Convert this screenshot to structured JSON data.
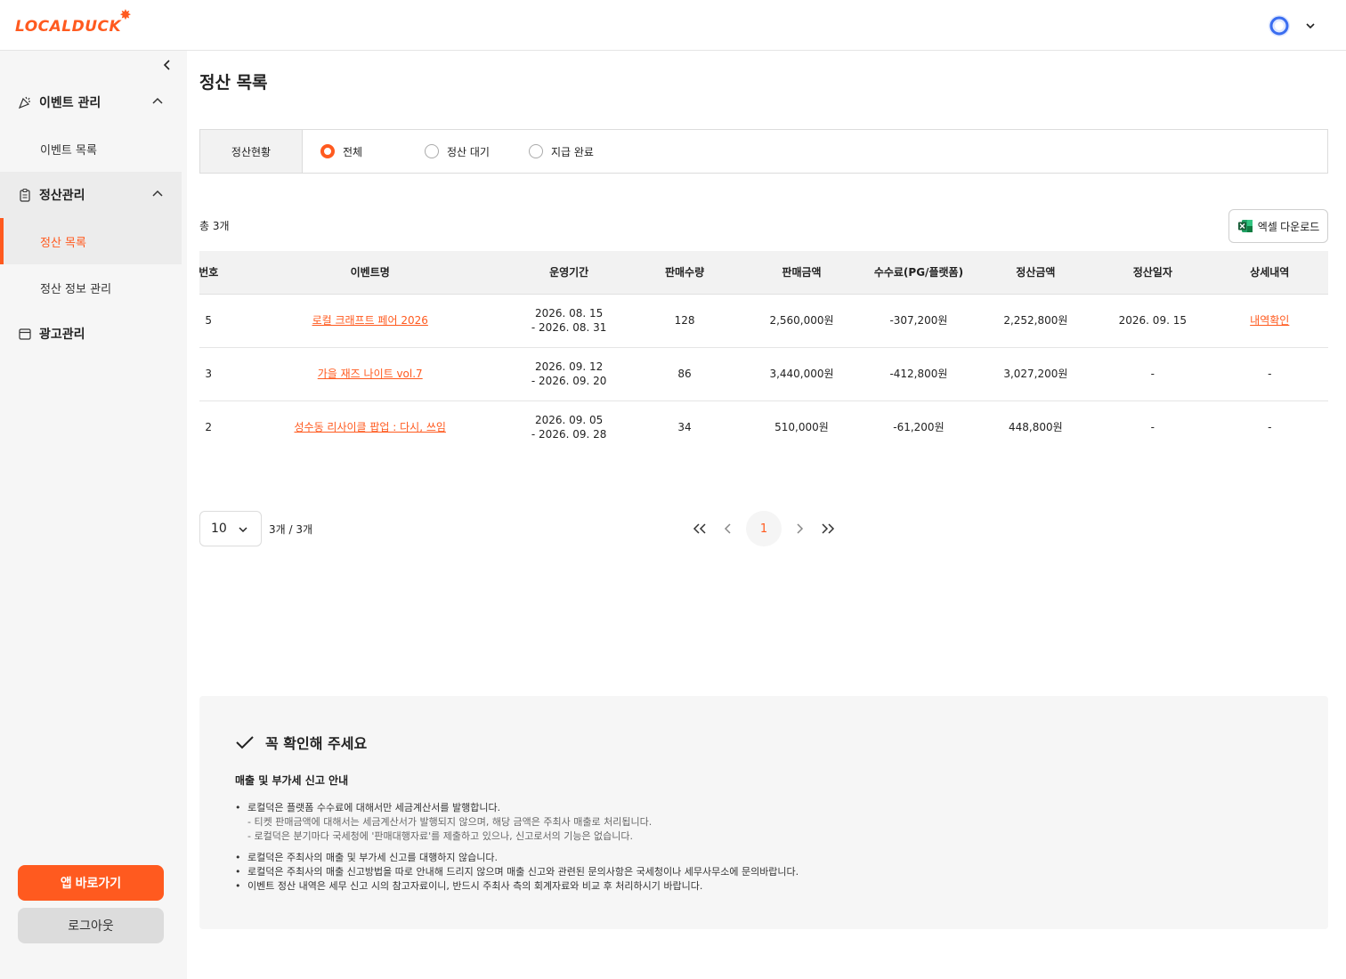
{
  "header": {
    "logo": "LOCALDUCK"
  },
  "sidebar": {
    "groups": [
      {
        "label": "이벤트 관리",
        "items": [
          "이벤트 목록"
        ]
      },
      {
        "label": "정산관리",
        "items": [
          "정산 목록",
          "정산 정보 관리"
        ]
      },
      {
        "label": "광고관리",
        "items": []
      }
    ],
    "active_item": "정산 목록",
    "app_button": "앱 바로가기",
    "logout_button": "로그아웃"
  },
  "page": {
    "title": "정산 목록"
  },
  "filter": {
    "label": "정산현황",
    "options": [
      "전체",
      "정산 대기",
      "지급 완료"
    ],
    "selected": "전체"
  },
  "summary": {
    "total": "총 3개",
    "excel_button": "엑셀 다운로드"
  },
  "table": {
    "headers": [
      "번호",
      "이벤트명",
      "운영기간",
      "판매수량",
      "판매금액",
      "수수료(PG/플랫폼)",
      "정산금액",
      "정산일자",
      "상세내역"
    ],
    "rows": [
      {
        "no": "5",
        "event": "로컬 크래프트 페어 2026",
        "period_start": "2026. 08. 15",
        "period_end": "- 2026. 08. 31",
        "qty": "128",
        "sales": "2,560,000원",
        "fee": "-307,200원",
        "settle": "2,252,800원",
        "date": "2026. 09. 15",
        "detail": "내역확인"
      },
      {
        "no": "3",
        "event": "가을 재즈 나이트 vol.7",
        "period_start": "2026. 09. 12",
        "period_end": "- 2026. 09. 20",
        "qty": "86",
        "sales": "3,440,000원",
        "fee": "-412,800원",
        "settle": "3,027,200원",
        "date": "-",
        "detail": "-"
      },
      {
        "no": "2",
        "event": "성수동 리사이클 팝업 : 다시, 쓰임",
        "period_start": "2026. 09. 05",
        "period_end": "- 2026. 09. 28",
        "qty": "34",
        "sales": "510,000원",
        "fee": "-61,200원",
        "settle": "448,800원",
        "date": "-",
        "detail": "-"
      }
    ]
  },
  "pagination": {
    "page_size": "10",
    "count_text": "3개 / 3개",
    "current_page": "1"
  },
  "notice": {
    "title": "꼭 확인해 주세요",
    "subtitle": "매출 및 부가세 신고 안내",
    "lines": [
      "로컬덕은 플랫폼 수수료에 대해서만 세금계산서를 발행합니다.",
      "- 티켓 판매금액에 대해서는 세금계산서가 발행되지 않으며, 해당 금액은 주최사 매출로 처리됩니다.",
      "- 로컬덕은 분기마다 국세청에 '판매대행자료'를 제출하고 있으나, 신고로서의 기능은 없습니다.",
      "로컬덕은 주최사의 매출 및 부가세 신고를 대행하지 않습니다.",
      "로컬덕은 주최사의 매출 신고방법을 따로 안내해 드리지 않으며 매출 신고와 관련된 문의사항은 국세청이나 세무사무소에 문의바랍니다.",
      "이벤트 정산 내역은 세무 신고 시의 참고자료이니, 반드시 주최사 측의 회계자료와 비교 후 처리하시기 바랍니다."
    ]
  },
  "colors": {
    "accent": "#ff5a1f",
    "sidebar_bg": "#f6f6f6",
    "excel_green": "#1d6f42"
  }
}
